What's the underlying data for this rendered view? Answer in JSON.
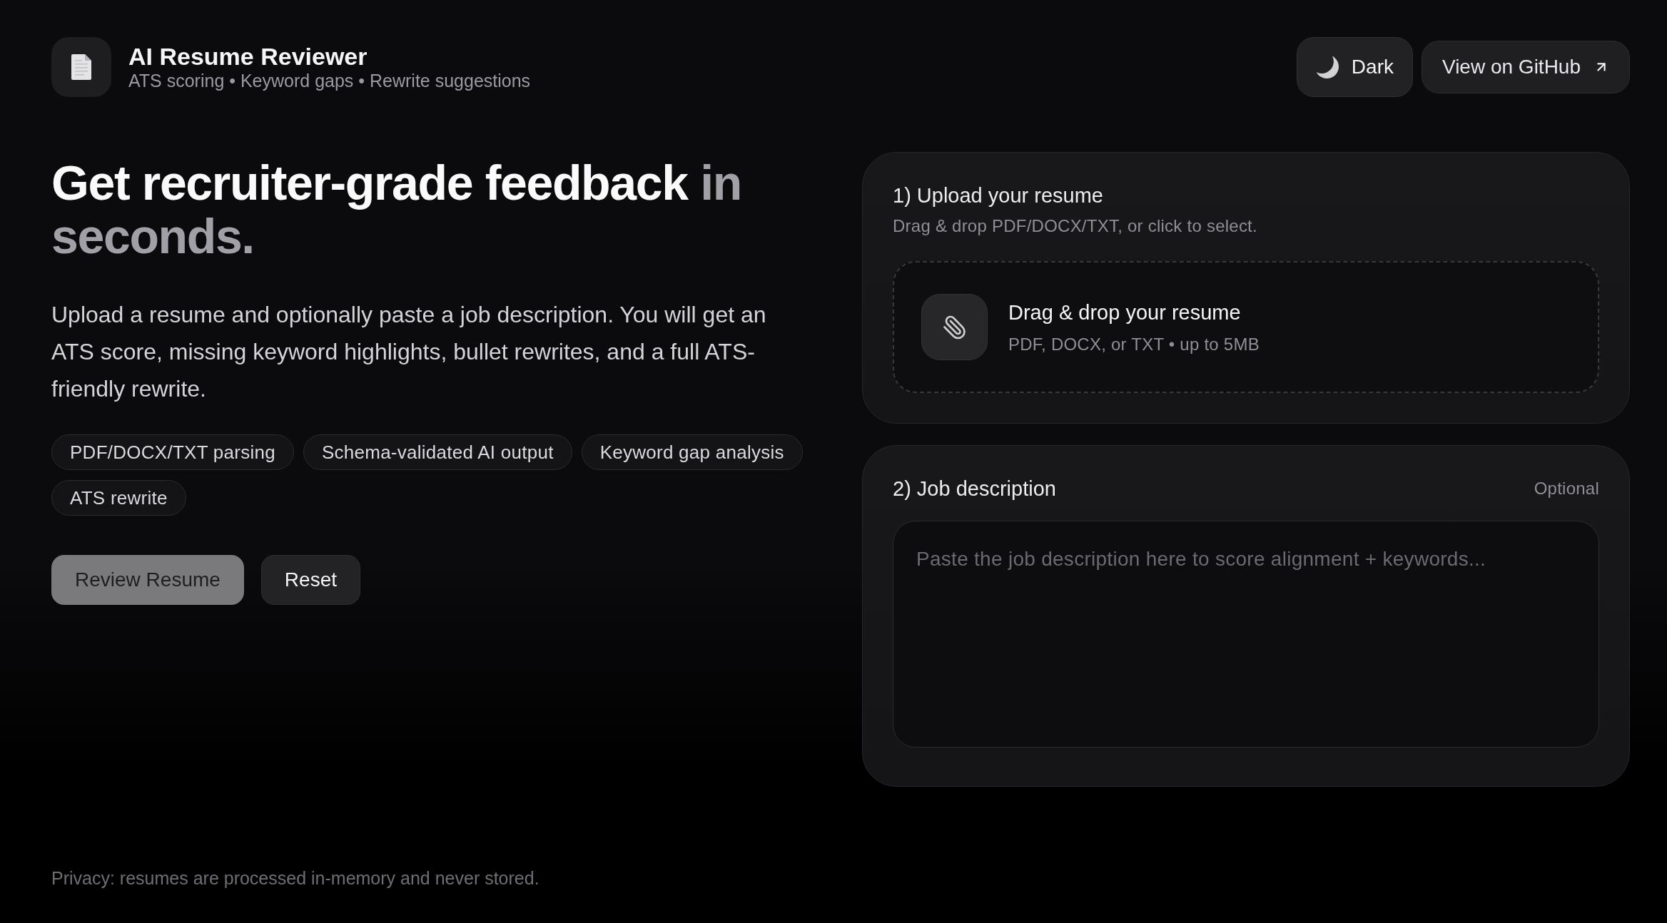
{
  "header": {
    "title": "AI Resume Reviewer",
    "subtitle": "ATS scoring • Keyword gaps • Rewrite suggestions",
    "theme_toggle": {
      "label": "Dark"
    },
    "github_link": {
      "label": "View on GitHub"
    }
  },
  "hero": {
    "heading": "Get recruiter-grade feedback",
    "heading_muted": "in seconds.",
    "description": "Upload a resume and optionally paste a job description. You will get an ATS score, missing keyword highlights, bullet rewrites, and a full ATS-friendly rewrite.",
    "features": [
      "PDF/DOCX/TXT parsing",
      "Schema-validated AI output",
      "Keyword gap analysis",
      "ATS rewrite"
    ],
    "buttons": [
      {
        "label": "Review Resume",
        "kind": "primary",
        "disabled": true
      },
      {
        "label": "Reset",
        "kind": "secondary",
        "disabled": false
      }
    ]
  },
  "upload_card": {
    "title": "1) Upload your resume",
    "hint": "Drag & drop PDF/DOCX/TXT, or click to select.",
    "dropzone": {
      "title": "Drag & drop your resume",
      "hint": "PDF, DOCX, or TXT • up to 5MB"
    }
  },
  "job_card": {
    "title": "2) Job description",
    "badge": "Optional",
    "textarea": {
      "placeholder": "Paste the job description here to score alignment + keywords..."
    }
  },
  "footer": {
    "privacy_note": "Privacy: resumes are processed in-memory and never stored."
  }
}
